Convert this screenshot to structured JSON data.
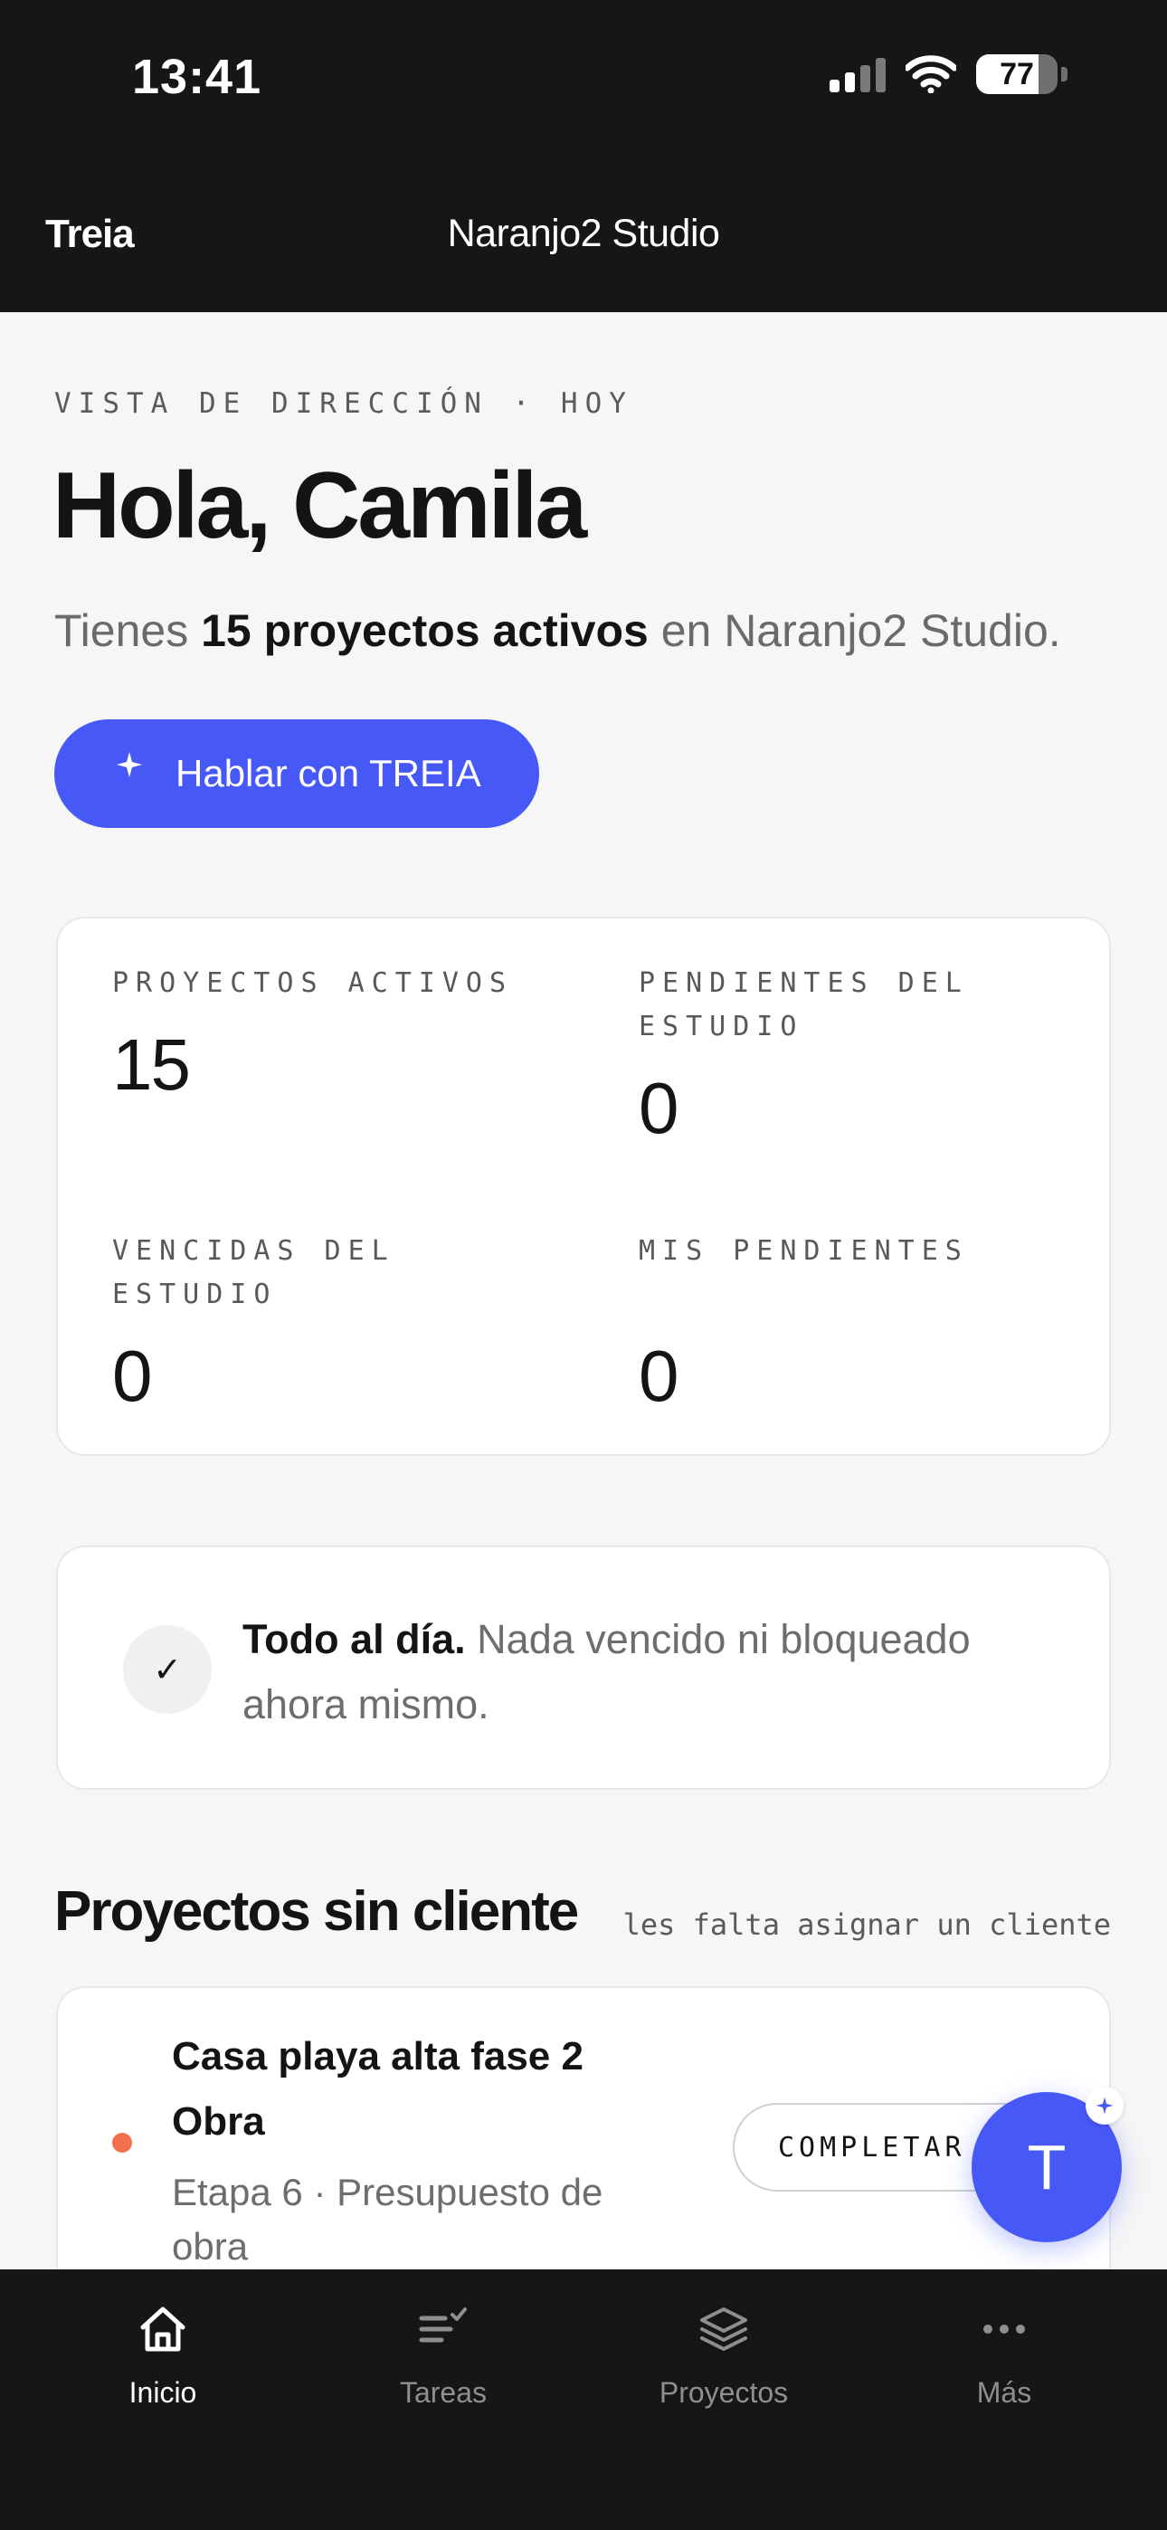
{
  "status_bar": {
    "time": "13:41",
    "battery": "77",
    "battery_level": 0.77
  },
  "header": {
    "brand": "Treia",
    "studio": "Naranjo2 Studio"
  },
  "hero": {
    "eyebrow": "VISTA DE DIRECCIÓN · HOY",
    "greeting": "Hola, Camila",
    "summary_pre": "Tienes ",
    "summary_bold": "15 proyectos activos",
    "summary_post": " en Naranjo2 Studio.",
    "cta_label": "Hablar con TREIA"
  },
  "stats": [
    {
      "label": "PROYECTOS ACTIVOS",
      "value": "15"
    },
    {
      "label": "PENDIENTES DEL ESTUDIO",
      "value": "0"
    },
    {
      "label": "VENCIDAS DEL ESTUDIO",
      "value": "0"
    },
    {
      "label": "MIS PENDIENTES",
      "value": "0"
    }
  ],
  "status_card": {
    "check": "✓",
    "bold": "Todo al día.",
    "text": " Nada vencido ni bloqueado ahora mismo."
  },
  "section": {
    "title": "Proyectos sin cliente",
    "subtitle": "les falta asignar un cliente"
  },
  "projects": [
    {
      "title": "Casa playa alta fase 2 Obra",
      "meta": "Etapa 6 · Presupuesto de obra",
      "action": "COMPLETAR →"
    }
  ],
  "fab": {
    "label": "T"
  },
  "tabs": [
    {
      "label": "Inicio",
      "icon": "home-icon"
    },
    {
      "label": "Tareas",
      "icon": "tasks-icon"
    },
    {
      "label": "Proyectos",
      "icon": "layers-icon"
    },
    {
      "label": "Más",
      "icon": "more-icon"
    }
  ],
  "colors": {
    "accent": "#4658f6",
    "dark": "#161616",
    "dot": "#f3714d"
  }
}
